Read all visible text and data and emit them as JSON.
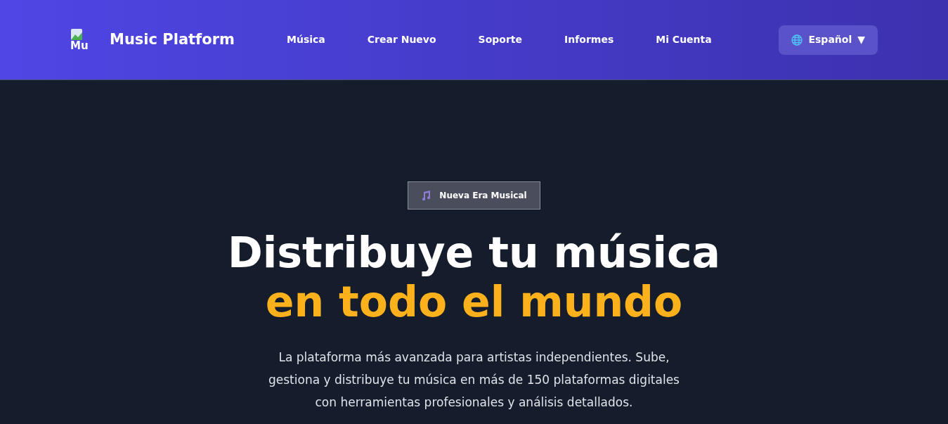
{
  "header": {
    "logo_alt": "Mu",
    "brand": "Music Platform",
    "nav": [
      {
        "label": "Música"
      },
      {
        "label": "Crear Nuevo"
      },
      {
        "label": "Soporte"
      },
      {
        "label": "Informes"
      },
      {
        "label": "Mi Cuenta"
      }
    ],
    "language": {
      "label": "Español",
      "caret": "▼"
    }
  },
  "hero": {
    "badge": "Nueva Era Musical",
    "headline": "Distribuye tu música ",
    "headline_highlight": "en todo el mundo",
    "description": "La plataforma más avanzada para artistas independientes. Sube, gestiona y distribuye tu música en más de 150 plataformas digitales con herramientas profesionales y análisis detallados."
  }
}
